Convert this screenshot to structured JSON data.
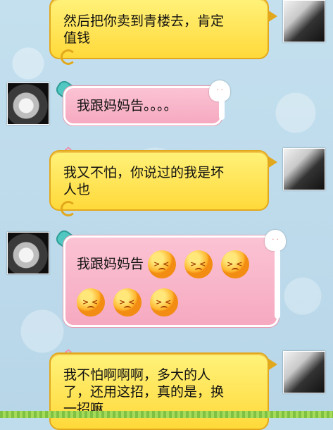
{
  "messages": [
    {
      "side": "right",
      "color": "yellow",
      "text": "然后把你卖到青楼去，肯定\n值钱"
    },
    {
      "side": "left",
      "color": "pink",
      "text": "我跟妈妈告。。。。"
    },
    {
      "side": "right",
      "color": "yellow",
      "text": "我又不怕，你说过的我是坏\n人也"
    },
    {
      "side": "left",
      "color": "pink",
      "text": "我跟妈妈告",
      "emoji_count": 6,
      "emoji": "angry-face-emoji"
    },
    {
      "side": "right",
      "color": "yellow",
      "text": "我不怕啊啊啊，多大的人\n了，还用这招，真的是，换\n一招嘛"
    }
  ],
  "colors": {
    "yellow": "#ffd93a",
    "pink": "#f6a9c0",
    "background": "#bfdcec"
  }
}
